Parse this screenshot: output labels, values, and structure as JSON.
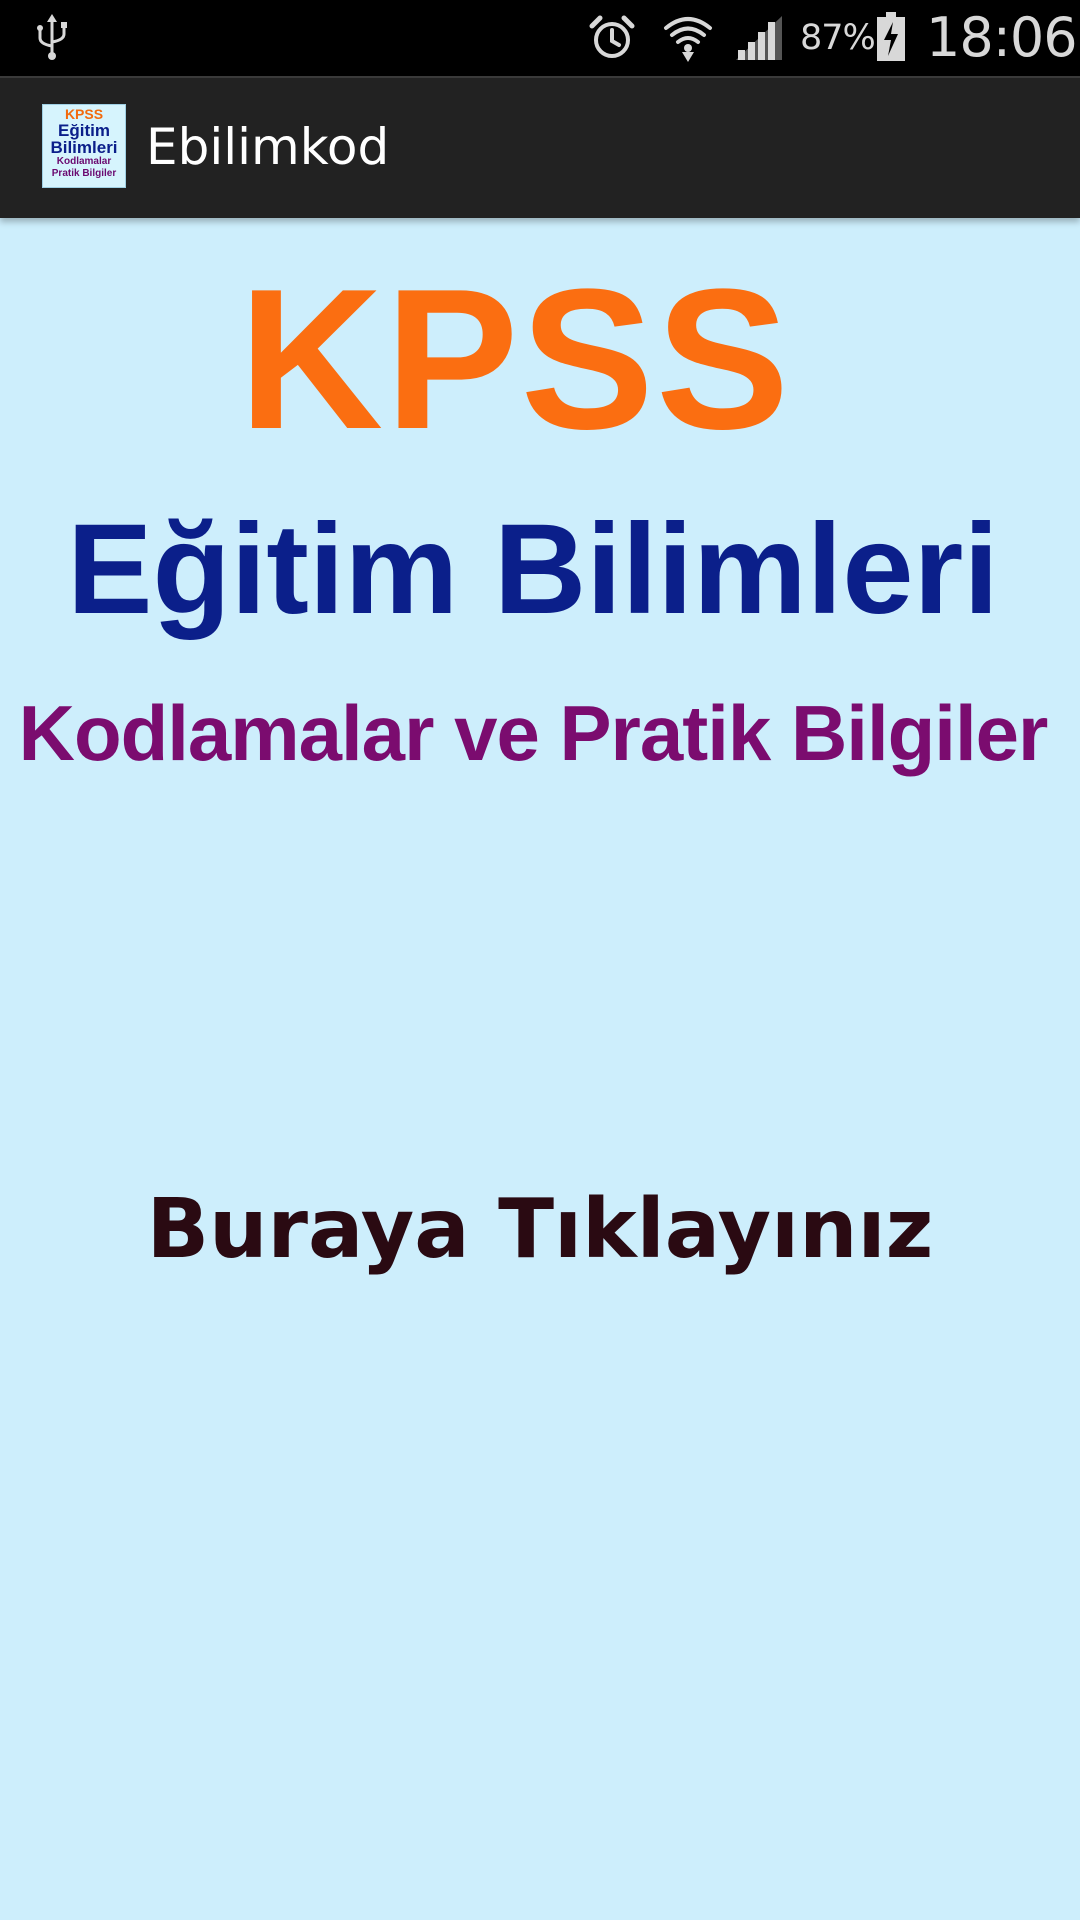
{
  "status_bar": {
    "battery_percent": "87%",
    "time": "18:06",
    "icons": [
      "usb-icon",
      "alarm-icon",
      "wifi-icon",
      "signal-icon",
      "battery-charging-icon"
    ]
  },
  "action_bar": {
    "title": "Ebilimkod",
    "app_icon": {
      "line1": "KPSS",
      "line2": "Eğitim",
      "line3": "Bilimleri",
      "line4": "Kodlamalar",
      "line5": "Pratik Bilgiler"
    }
  },
  "banner": {
    "kpss": "KPSS",
    "title": "Eğitim Bilimleri",
    "subtitle": "Kodlamalar ve Pratik Bilgiler"
  },
  "main": {
    "click_here": "Buraya Tıklayınız"
  },
  "colors": {
    "background": "#cdeefc",
    "action_bar": "#222222",
    "kpss_orange": "#fb6e11",
    "title_blue": "#0b1f8a",
    "subtitle_purple": "#7b0c6f",
    "click_text": "#2a0a12"
  }
}
